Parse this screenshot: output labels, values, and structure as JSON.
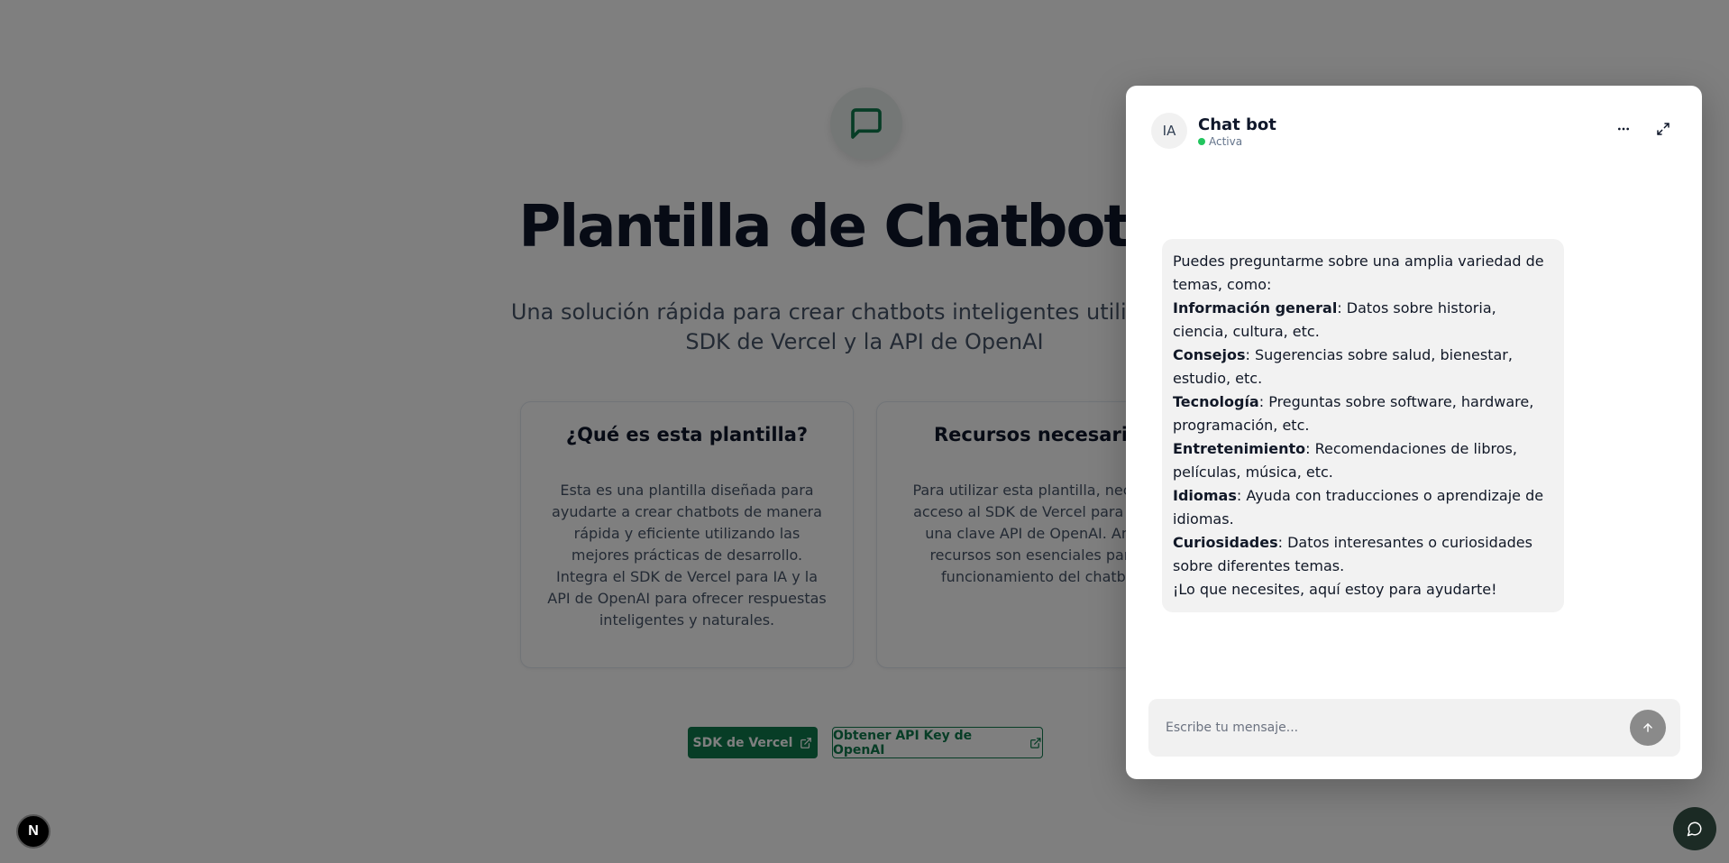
{
  "landing": {
    "title": "Plantilla de Chatbot IA",
    "subtitle_line1": "Una solución rápida para crear chatbots inteligentes utilizando el",
    "subtitle_line2": "SDK de Vercel y la API de OpenAI",
    "card1": {
      "title": "¿Qué es esta plantilla?",
      "text": "Esta es una plantilla diseñada para ayudarte a crear chatbots de manera rápida y eficiente utilizando las mejores prácticas de desarrollo. Integra el SDK de Vercel para IA y la API de OpenAI para ofrecer respuestas inteligentes y naturales."
    },
    "card2": {
      "title": "Recursos necesarios",
      "text": "Para utilizar esta plantilla, necesitas acceso al SDK de Vercel para la IA y una clave API de OpenAI. Ambos recursos son esenciales para el funcionamiento del chatbot."
    },
    "button_sdk": "SDK de Vercel",
    "button_api": "Obtener API Key de OpenAI",
    "next_badge": "N"
  },
  "chat": {
    "avatar": "IA",
    "title": "Chat bot",
    "status": "Activa",
    "message": {
      "intro_1": "Puedes preguntarme sobre una amplia variedad de",
      "intro_2": "temas, como:",
      "items": [
        {
          "label": "Información general",
          "text": ": Datos sobre historia, ciencia, cultura, etc."
        },
        {
          "label": "Consejos",
          "text": ": Sugerencias sobre salud, bienestar, estudio, etc."
        },
        {
          "label": "Tecnología",
          "text": ": Preguntas sobre software, hardware, programación, etc."
        },
        {
          "label": "Entretenimiento",
          "text": ": Recomendaciones de libros, películas, música, etc."
        },
        {
          "label": "Idiomas",
          "text": ": Ayuda con traducciones o aprendizaje de idiomas."
        },
        {
          "label": "Curiosidades",
          "text": ": Datos interesantes o curiosidades sobre diferentes temas."
        }
      ],
      "outro": "¡Lo que necesites, aquí estoy para ayudarte!"
    },
    "input_placeholder": "Escribe tu mensaje...",
    "input_value": ""
  },
  "colors": {
    "brand": "#0e7a4d",
    "status": "#22c55e",
    "overlay": "rgba(0,0,0,0.50)"
  },
  "icons": {
    "hero": "message-square-icon",
    "menu": "more-horizontal-icon",
    "expand": "maximize-icon",
    "send": "arrow-up-icon",
    "external": "external-link-icon",
    "chat_fab": "message-circle-icon"
  }
}
